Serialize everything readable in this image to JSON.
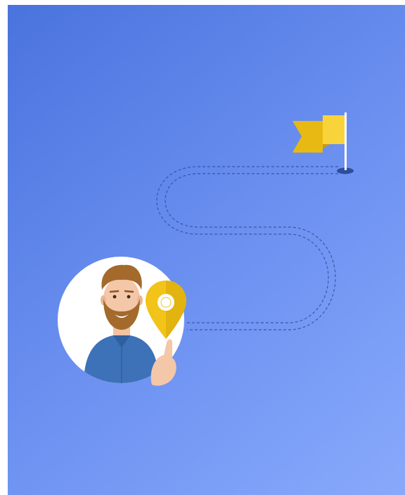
{
  "colors": {
    "background_start": "#4a73dd",
    "background_end": "#88a9fb",
    "flag": "#f2c318",
    "pin": "#f2c318",
    "path_dash": "#2f4f99",
    "shirt": "#3d72b8",
    "hair": "#a36a2c"
  },
  "illustration": {
    "icons": [
      "flag-icon",
      "route-path",
      "location-pin-icon",
      "avatar"
    ]
  }
}
